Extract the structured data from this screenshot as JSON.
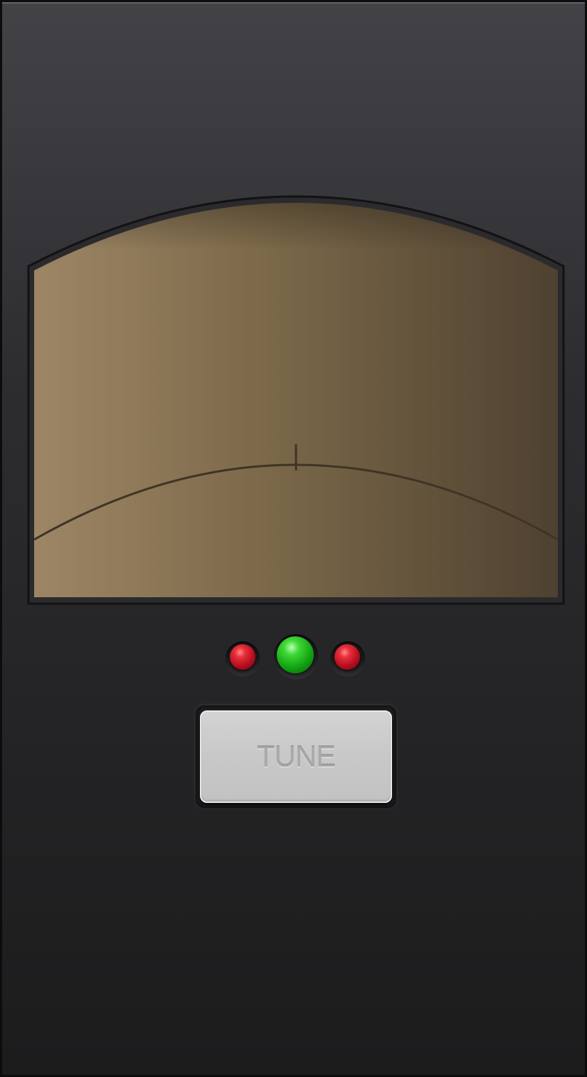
{
  "tuner": {
    "meter": {
      "center_mark": "center-tick",
      "needle_visible": false
    },
    "indicators": {
      "flat": {
        "state": "off",
        "color": "#c8182a"
      },
      "in_tune": {
        "state": "on",
        "color": "#2cc52a"
      },
      "sharp": {
        "state": "off",
        "color": "#c8182a"
      }
    },
    "tune_button": {
      "label": "TUNE"
    }
  }
}
